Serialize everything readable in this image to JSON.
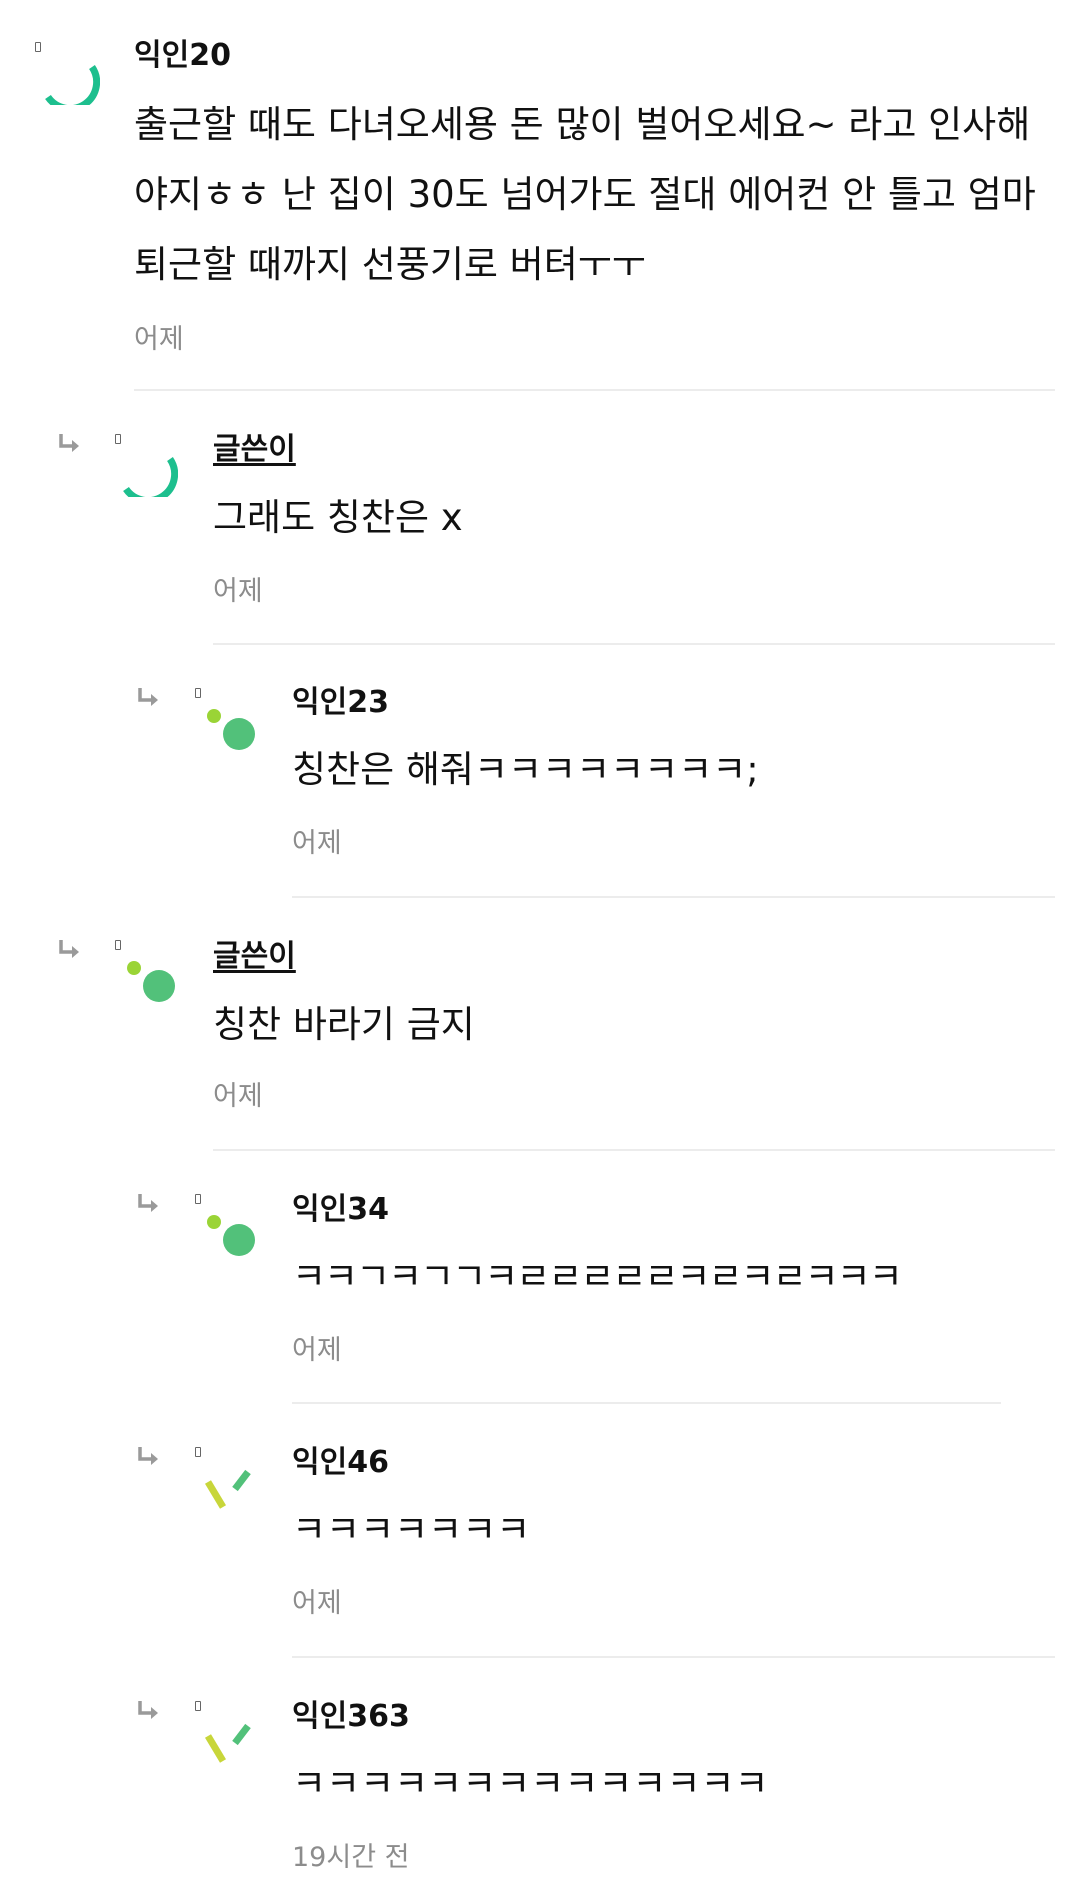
{
  "comments": [
    {
      "author": "익인20",
      "lines": [
        "출근할 때도 다녀오세용 돈 많이 벌어오세요~ 라고 인사해",
        "야지ㅎㅎ 난 집이 30도 넘어가도 절대 에어컨 안 틀고 엄마",
        "퇴근할 때까지 선풍기로 버텨ㅜㅜ"
      ],
      "time": "어제"
    },
    {
      "author": "글쓴이",
      "text": "그래도 칭찬은 x",
      "time": "어제"
    },
    {
      "author": "익인23",
      "text": "칭찬은 해줘ㅋㅋㅋㅋㅋㅋㅋㅋ;",
      "time": "어제"
    },
    {
      "author": "글쓴이",
      "text": "칭찬 바라기 금지",
      "time": "어제"
    },
    {
      "author": "익인34",
      "text": "ㅋㅋㄱㅋㄱㄱㅋㄹㄹㄹㄹㄹㅋㄹㅋㄹㅋㅋㅋ",
      "time": "어제"
    },
    {
      "author": "익인46",
      "text": "ㅋㅋㅋㅋㅋㅋㅋ",
      "time": "어제"
    },
    {
      "author": "익인363",
      "text": "ㅋㅋㅋㅋㅋㅋㅋㅋㅋㅋㅋㅋㅋㅋ",
      "time": "19시간 전"
    }
  ],
  "colors": {
    "teal": "#1dbf8e",
    "green": "#52c17a",
    "lime": "#9ad436",
    "yellow_green": "#c8d63a",
    "timestamp": "#8c8c8c"
  }
}
